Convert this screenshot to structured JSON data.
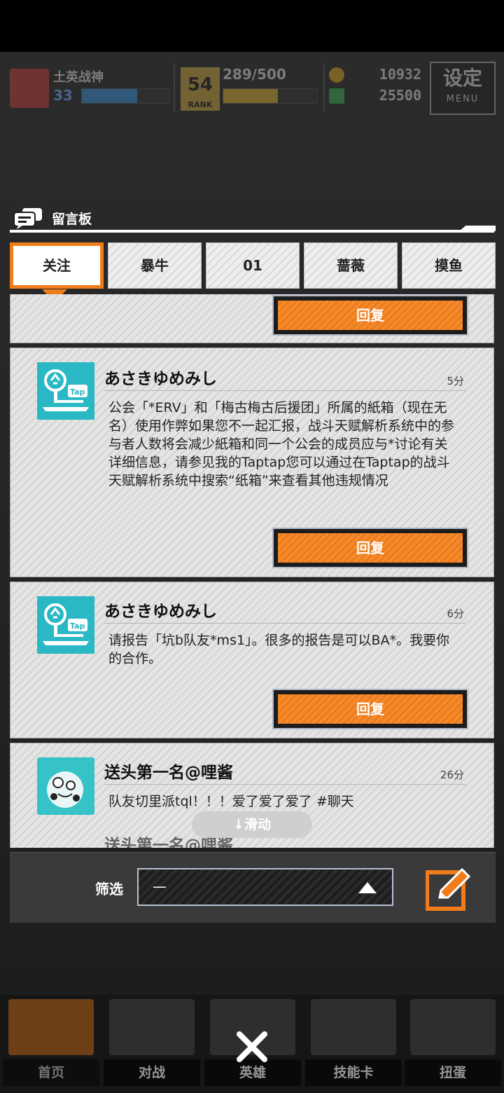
{
  "status": {
    "player_name": "土英战神",
    "level": "33",
    "rank_number": "54",
    "rank_label": "RANK",
    "stamina": "289/500",
    "gold": "10932",
    "gems": "25500",
    "menu_big": "设定",
    "menu_small": "MENU"
  },
  "board": {
    "title": "留言板"
  },
  "tabs": [
    "关注",
    "暴牛",
    "01",
    "蔷薇",
    "摸鱼"
  ],
  "reply_label": "回复",
  "messages": [
    {
      "user": "あさきゆめみし",
      "time": "5分",
      "text": "公会「*ERV」和「梅古梅古后援团」所属的紙箱（现在无名）使用作弊如果您不一起汇报，战斗天赋解析系统中的参与者人数将会减少紙箱和同一个公会的成员应与*讨论有关详细信息，请参见我的Taptap您可以通过在Taptap的战斗天赋解析系统中搜索“纸箱”来查看其他违规情况"
    },
    {
      "user": "あさきゆめみし",
      "time": "6分",
      "text": "请报告「坑b队友*ms1」。很多的报告是可以BA*。我要你的合作。"
    },
    {
      "user": "送头第一名@哩酱",
      "time": "26分",
      "text": "队友切里派tql！！！爱了爱了爱了 #聊天"
    }
  ],
  "partial_next_user": "送头第一名@哩酱",
  "scroll_hint": "↓滑动",
  "filter": {
    "label": "筛选",
    "value": "—"
  },
  "nav": [
    "首页",
    "对战",
    "英雄",
    "技能卡",
    "扭蛋"
  ],
  "colors": {
    "accent": "#f07d1a",
    "tap_teal": "#2ab8c4"
  }
}
